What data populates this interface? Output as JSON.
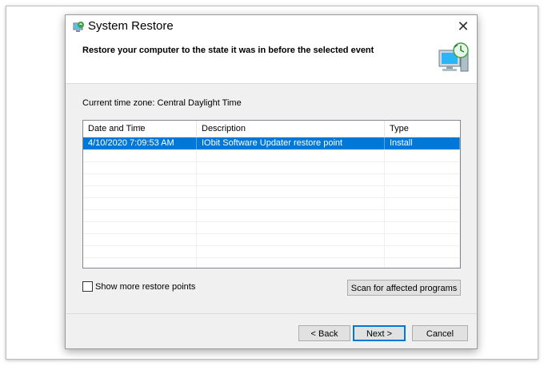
{
  "window": {
    "title": "System Restore",
    "close_glyph": "✕"
  },
  "header": {
    "subtitle": "Restore your computer to the state it was in before the selected event",
    "image_icon": "system-restore-computer-icon"
  },
  "timezone_label": "Current time zone: Central Daylight Time",
  "table": {
    "columns": [
      "Date and Time",
      "Description",
      "Type"
    ],
    "sort_glyph": "⌄",
    "rows": [
      {
        "date": "4/10/2020 7:09:53 AM",
        "description": "IObit Software Updater restore point",
        "type": "Install",
        "selected": true
      }
    ]
  },
  "show_more": {
    "label": "Show more restore points",
    "checked": false
  },
  "buttons": {
    "scan": "Scan for affected programs",
    "back": "< Back",
    "next": "Next >",
    "cancel": "Cancel"
  },
  "colors": {
    "selection": "#0078d7",
    "dialog_bg": "#f0f0f0",
    "header_bg": "#ffffff"
  }
}
